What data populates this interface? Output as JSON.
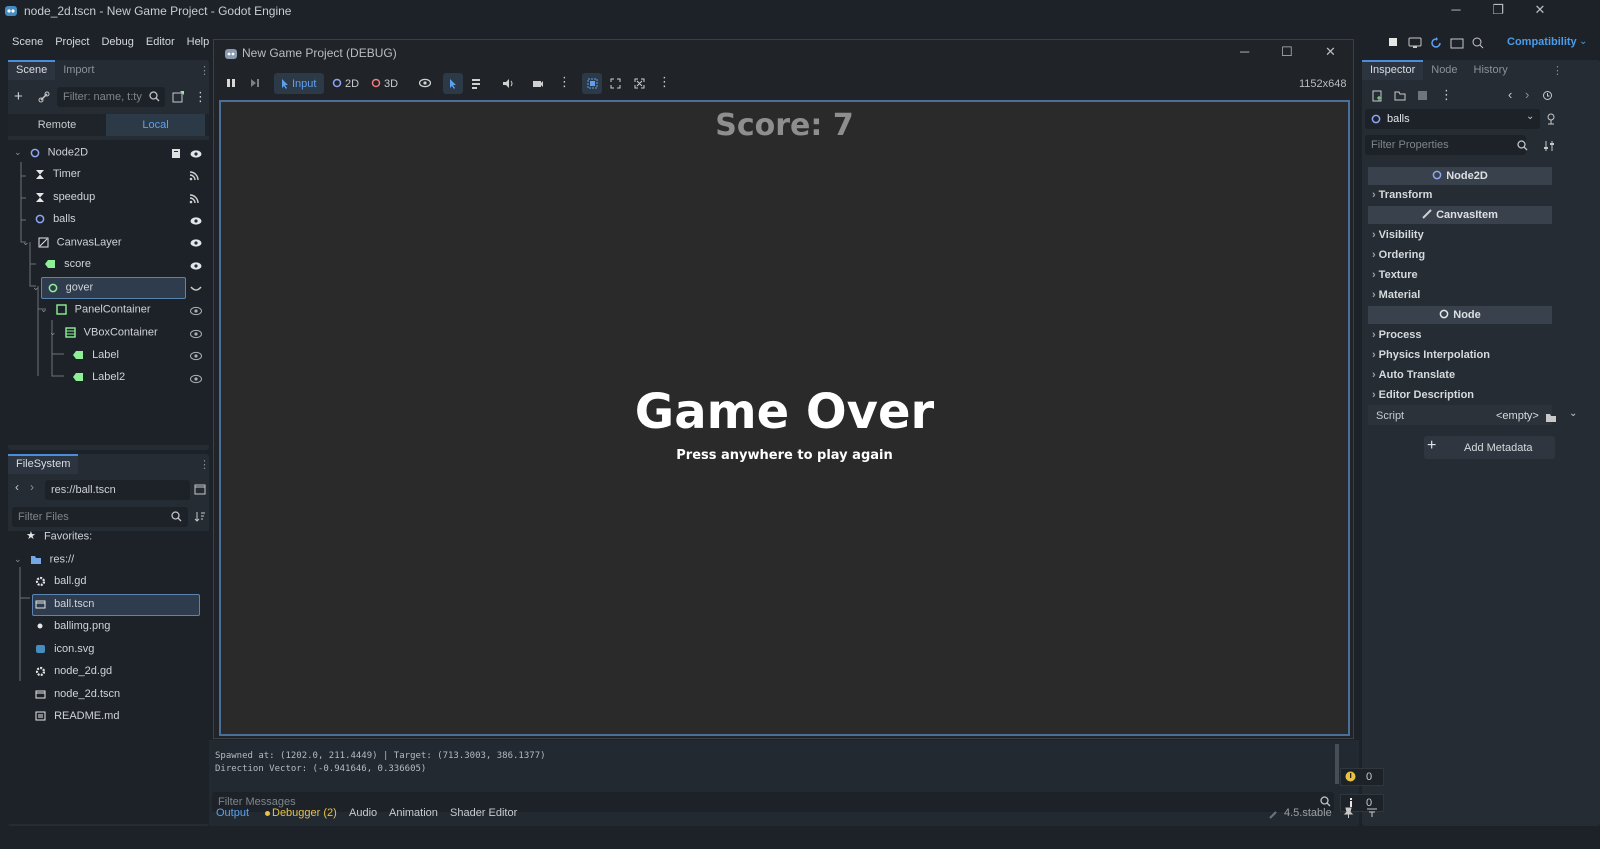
{
  "window": {
    "title": "node_2d.tscn - New Game Project - Godot Engine"
  },
  "menu": [
    "Scene",
    "Project",
    "Debug",
    "Editor",
    "Help"
  ],
  "renderer": "Compatibility",
  "scene_dock": {
    "tabs": [
      "Scene",
      "Import"
    ],
    "filter_placeholder": "Filter: name, t:ty",
    "remote_label": "Remote",
    "local_label": "Local",
    "nodes": [
      {
        "label": "Node2D",
        "icon": "node2d-icon"
      },
      {
        "label": "Timer",
        "icon": "timer-icon"
      },
      {
        "label": "speedup",
        "icon": "timer-icon"
      },
      {
        "label": "balls",
        "icon": "node2d-icon"
      },
      {
        "label": "CanvasLayer",
        "icon": "canvaslayer-icon"
      },
      {
        "label": "score",
        "icon": "label-icon"
      },
      {
        "label": "gover",
        "icon": "control-icon"
      },
      {
        "label": "PanelContainer",
        "icon": "panel-icon"
      },
      {
        "label": "VBoxContainer",
        "icon": "vbox-icon"
      },
      {
        "label": "Label",
        "icon": "label-icon"
      },
      {
        "label": "Label2",
        "icon": "label-icon"
      }
    ]
  },
  "filesystem": {
    "tab": "FileSystem",
    "path": "res://ball.tscn",
    "filter_placeholder": "Filter Files",
    "favorites": "Favorites:",
    "root": "res://",
    "files": [
      "ball.gd",
      "ball.tscn",
      "ballimg.png",
      "icon.svg",
      "node_2d.gd",
      "node_2d.tscn",
      "README.md"
    ]
  },
  "game": {
    "title": "New Game Project (DEBUG)",
    "input_label": "Input",
    "mode_2d": "2D",
    "mode_3d": "3D",
    "resolution": "1152x648",
    "score": "Score: 7",
    "game_over": "Game Over",
    "subtitle": "Press anywhere to play again"
  },
  "inspector": {
    "tabs": [
      "Inspector",
      "Node",
      "History"
    ],
    "selected": "balls",
    "filter_placeholder": "Filter Properties",
    "sections": {
      "node2d": "Node2D",
      "transform": "Transform",
      "canvasitem": "CanvasItem",
      "visibility": "Visibility",
      "ordering": "Ordering",
      "texture": "Texture",
      "material": "Material",
      "node": "Node",
      "process": "Process",
      "physics_interp": "Physics Interpolation",
      "auto_translate": "Auto Translate",
      "editor_desc": "Editor Description"
    },
    "script_label": "Script",
    "script_value": "<empty>",
    "add_metadata": "Add Metadata"
  },
  "output": {
    "lines": [
      "Spawned at: (1202.0, 211.4449) | Target: (713.3003, 386.1377)",
      "Direction Vector: (-0.941646, 0.336605)"
    ],
    "filter_placeholder": "Filter Messages",
    "warnings": "0",
    "infos": "0"
  },
  "bottom_tabs": [
    "Output",
    "Debugger (2)",
    "Audio",
    "Animation",
    "Shader Editor"
  ],
  "version": "4.5.stable",
  "colors": {
    "accent": "#4c8ddb",
    "label_green": "#8eef97",
    "node_blue": "#8da5f3"
  }
}
